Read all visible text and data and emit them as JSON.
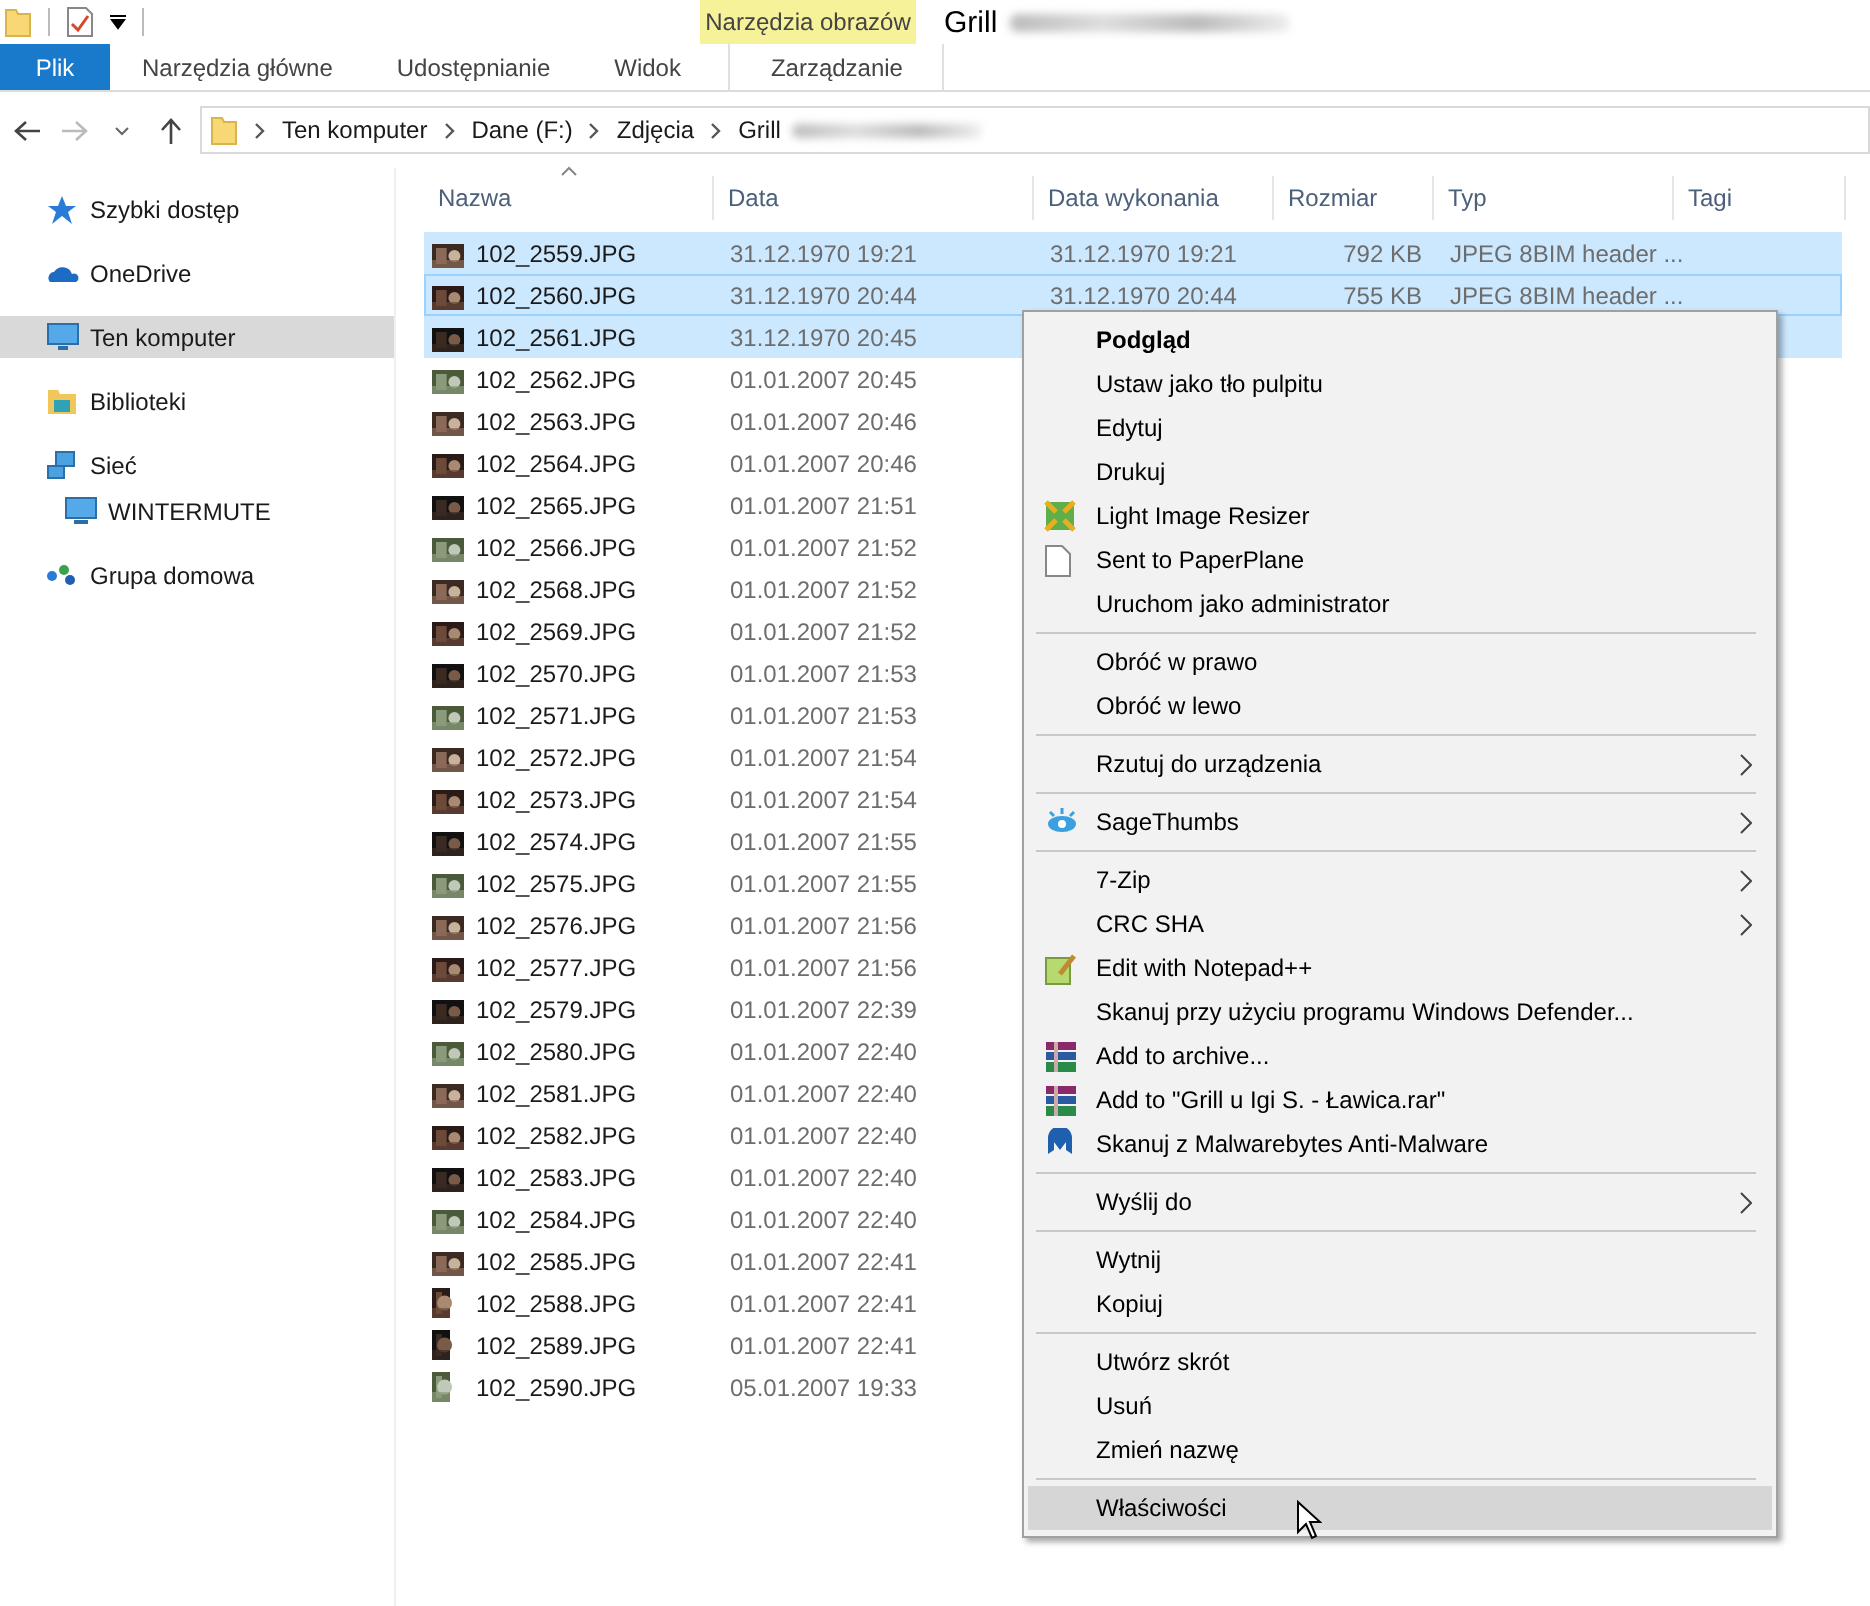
{
  "window": {
    "title": "Grill",
    "title_redacted": true
  },
  "ribbon": {
    "context_group": "Narzędzia obrazów",
    "tabs": [
      {
        "label": "Plik",
        "kind": "file",
        "selected": false
      },
      {
        "label": "Narzędzia główne",
        "kind": "normal",
        "selected": false
      },
      {
        "label": "Udostępnianie",
        "kind": "normal",
        "selected": false
      },
      {
        "label": "Widok",
        "kind": "normal",
        "selected": false
      },
      {
        "label": "Zarządzanie",
        "kind": "contextual",
        "selected": false
      }
    ]
  },
  "address_bar": {
    "crumbs": [
      "Ten komputer",
      "Dane (F:)",
      "Zdjęcia",
      "Grill"
    ]
  },
  "sidebar": {
    "items": [
      {
        "label": "Szybki dostęp",
        "selected": false
      },
      {
        "label": "OneDrive",
        "selected": false
      },
      {
        "label": "Ten komputer",
        "selected": true
      },
      {
        "label": "Biblioteki",
        "selected": false
      },
      {
        "label": "Sieć",
        "selected": false,
        "children": [
          {
            "label": "WINTERMUTE",
            "selected": false
          }
        ]
      },
      {
        "label": "Grupa domowa",
        "selected": false
      }
    ]
  },
  "table": {
    "columns": [
      "Nazwa",
      "Data",
      "Data wykonania",
      "Rozmiar",
      "Typ",
      "Tagi"
    ],
    "rows": [
      {
        "name": "102_2559.JPG",
        "date": "31.12.1970 19:21",
        "date_taken": "31.12.1970 19:21",
        "size": "792 KB",
        "type": "JPEG 8BIM header ...",
        "selected": true,
        "focused": false
      },
      {
        "name": "102_2560.JPG",
        "date": "31.12.1970 20:44",
        "date_taken": "31.12.1970 20:44",
        "size": "755 KB",
        "type": "JPEG 8BIM header ...",
        "selected": true,
        "focused": true
      },
      {
        "name": "102_2561.JPG",
        "date": "31.12.1970 20:45",
        "selected": true,
        "focused": false
      },
      {
        "name": "102_2562.JPG",
        "date": "01.01.2007 20:45",
        "selected": false,
        "focused": false
      },
      {
        "name": "102_2563.JPG",
        "date": "01.01.2007 20:46",
        "selected": false,
        "focused": false
      },
      {
        "name": "102_2564.JPG",
        "date": "01.01.2007 20:46",
        "selected": false,
        "focused": false
      },
      {
        "name": "102_2565.JPG",
        "date": "01.01.2007 21:51",
        "selected": false,
        "focused": false
      },
      {
        "name": "102_2566.JPG",
        "date": "01.01.2007 21:52",
        "selected": false,
        "focused": false
      },
      {
        "name": "102_2568.JPG",
        "date": "01.01.2007 21:52",
        "selected": false,
        "focused": false
      },
      {
        "name": "102_2569.JPG",
        "date": "01.01.2007 21:52",
        "selected": false,
        "focused": false
      },
      {
        "name": "102_2570.JPG",
        "date": "01.01.2007 21:53",
        "selected": false,
        "focused": false
      },
      {
        "name": "102_2571.JPG",
        "date": "01.01.2007 21:53",
        "selected": false,
        "focused": false
      },
      {
        "name": "102_2572.JPG",
        "date": "01.01.2007 21:54",
        "selected": false,
        "focused": false
      },
      {
        "name": "102_2573.JPG",
        "date": "01.01.2007 21:54",
        "selected": false,
        "focused": false
      },
      {
        "name": "102_2574.JPG",
        "date": "01.01.2007 21:55",
        "selected": false,
        "focused": false
      },
      {
        "name": "102_2575.JPG",
        "date": "01.01.2007 21:55",
        "selected": false,
        "focused": false
      },
      {
        "name": "102_2576.JPG",
        "date": "01.01.2007 21:56",
        "selected": false,
        "focused": false
      },
      {
        "name": "102_2577.JPG",
        "date": "01.01.2007 21:56",
        "selected": false,
        "focused": false
      },
      {
        "name": "102_2579.JPG",
        "date": "01.01.2007 22:39",
        "selected": false,
        "focused": false
      },
      {
        "name": "102_2580.JPG",
        "date": "01.01.2007 22:40",
        "selected": false,
        "focused": false
      },
      {
        "name": "102_2581.JPG",
        "date": "01.01.2007 22:40",
        "selected": false,
        "focused": false
      },
      {
        "name": "102_2582.JPG",
        "date": "01.01.2007 22:40",
        "selected": false,
        "focused": false
      },
      {
        "name": "102_2583.JPG",
        "date": "01.01.2007 22:40",
        "selected": false,
        "focused": false
      },
      {
        "name": "102_2584.JPG",
        "date": "01.01.2007 22:40",
        "selected": false,
        "focused": false
      },
      {
        "name": "102_2585.JPG",
        "date": "01.01.2007 22:41",
        "selected": false,
        "focused": false
      },
      {
        "name": "102_2588.JPG",
        "date": "01.01.2007 22:41",
        "selected": false,
        "focused": false
      },
      {
        "name": "102_2589.JPG",
        "date": "01.01.2007 22:41",
        "selected": false,
        "focused": false
      },
      {
        "name": "102_2590.JPG",
        "date": "05.01.2007 19:33",
        "selected": false,
        "focused": false
      }
    ]
  },
  "context_menu": {
    "items": [
      {
        "kind": "item",
        "label": "Podgląd",
        "bold": true,
        "submenu": false,
        "selected": false
      },
      {
        "kind": "item",
        "label": "Ustaw jako tło pulpitu",
        "bold": false,
        "submenu": false,
        "selected": false
      },
      {
        "kind": "item",
        "label": "Edytuj",
        "bold": false,
        "submenu": false,
        "selected": false
      },
      {
        "kind": "item",
        "label": "Drukuj",
        "bold": false,
        "submenu": false,
        "selected": false
      },
      {
        "kind": "item",
        "label": "Light Image Resizer",
        "bold": false,
        "submenu": false,
        "selected": false
      },
      {
        "kind": "item",
        "label": "Sent to PaperPlane",
        "bold": false,
        "submenu": false,
        "selected": false
      },
      {
        "kind": "item",
        "label": "Uruchom jako administrator",
        "bold": false,
        "submenu": false,
        "selected": false
      },
      {
        "kind": "separator"
      },
      {
        "kind": "item",
        "label": "Obróć w prawo",
        "bold": false,
        "submenu": false,
        "selected": false
      },
      {
        "kind": "item",
        "label": "Obróć w lewo",
        "bold": false,
        "submenu": false,
        "selected": false
      },
      {
        "kind": "separator"
      },
      {
        "kind": "item",
        "label": "Rzutuj do urządzenia",
        "bold": false,
        "submenu": true,
        "selected": false
      },
      {
        "kind": "separator"
      },
      {
        "kind": "item",
        "label": "SageThumbs",
        "bold": false,
        "submenu": true,
        "selected": false
      },
      {
        "kind": "separator"
      },
      {
        "kind": "item",
        "label": "7-Zip",
        "bold": false,
        "submenu": true,
        "selected": false
      },
      {
        "kind": "item",
        "label": "CRC SHA",
        "bold": false,
        "submenu": true,
        "selected": false
      },
      {
        "kind": "item",
        "label": "Edit with Notepad++",
        "bold": false,
        "submenu": false,
        "selected": false
      },
      {
        "kind": "item",
        "label": "Skanuj przy użyciu programu Windows Defender...",
        "bold": false,
        "submenu": false,
        "selected": false
      },
      {
        "kind": "item",
        "label": "Add to archive...",
        "bold": false,
        "submenu": false,
        "selected": false
      },
      {
        "kind": "item",
        "label": "Add to \"Grill u Igi S. - Ławica.rar\"",
        "bold": false,
        "submenu": false,
        "selected": false
      },
      {
        "kind": "item",
        "label": "Skanuj z Malwarebytes Anti-Malware",
        "bold": false,
        "submenu": false,
        "selected": false
      },
      {
        "kind": "separator"
      },
      {
        "kind": "item",
        "label": "Wyślij do",
        "bold": false,
        "submenu": true,
        "selected": false
      },
      {
        "kind": "separator"
      },
      {
        "kind": "item",
        "label": "Wytnij",
        "bold": false,
        "submenu": false,
        "selected": false
      },
      {
        "kind": "item",
        "label": "Kopiuj",
        "bold": false,
        "submenu": false,
        "selected": false
      },
      {
        "kind": "separator"
      },
      {
        "kind": "item",
        "label": "Utwórz skrót",
        "bold": false,
        "submenu": false,
        "selected": false
      },
      {
        "kind": "item",
        "label": "Usuń",
        "bold": false,
        "submenu": false,
        "selected": false
      },
      {
        "kind": "item",
        "label": "Zmień nazwę",
        "bold": false,
        "submenu": false,
        "selected": false
      },
      {
        "kind": "separator"
      },
      {
        "kind": "item",
        "label": "Właściwości",
        "bold": false,
        "submenu": false,
        "selected": true
      }
    ]
  }
}
